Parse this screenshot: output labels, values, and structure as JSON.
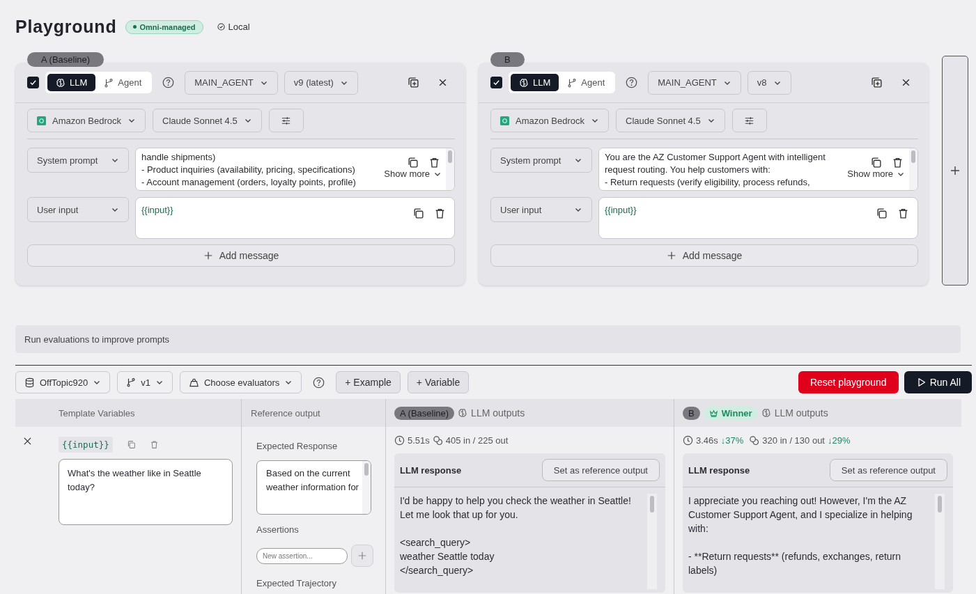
{
  "header": {
    "title": "Playground",
    "badge": "Omni-managed",
    "location": "Local"
  },
  "panels": [
    {
      "tag": "A (Baseline)",
      "enabled": true,
      "modes": [
        {
          "label": "LLM",
          "selected": true
        },
        {
          "label": "Agent",
          "selected": false
        }
      ],
      "agent": "MAIN_AGENT",
      "version": "v9 (latest)",
      "provider": "Amazon Bedrock",
      "model": "Claude Sonnet 4.5",
      "messages": [
        {
          "kind": "system",
          "role": "System prompt",
          "text": "handle shipments)\n- Product inquiries (availability, pricing, specifications)\n- Account management (orders, loyalty points, profile)",
          "show_more": "Show more"
        },
        {
          "kind": "user",
          "role": "User input",
          "text": "{{input}}"
        }
      ],
      "add_message": "Add message"
    },
    {
      "tag": "B",
      "enabled": true,
      "modes": [
        {
          "label": "LLM",
          "selected": true
        },
        {
          "label": "Agent",
          "selected": false
        }
      ],
      "agent": "MAIN_AGENT",
      "version": "v8",
      "provider": "Amazon Bedrock",
      "model": "Claude Sonnet 4.5",
      "messages": [
        {
          "kind": "system",
          "role": "System prompt",
          "text": "You are the AZ Customer Support Agent with intelligent\nrequest routing. You help customers with:\n- Return requests (verify eligibility, process refunds,",
          "show_more": "Show more"
        },
        {
          "kind": "user",
          "role": "User input",
          "text": "{{input}}"
        }
      ],
      "add_message": "Add message"
    }
  ],
  "hint": "Run evaluations to improve prompts",
  "toolbar": {
    "dataset": "OffTopic920",
    "dataset_version": "v1",
    "evaluators": "Choose evaluators",
    "add_example": "+ Example",
    "add_variable": "+ Variable",
    "reset": "Reset playground",
    "run": "Run All"
  },
  "table": {
    "columns": [
      {
        "label": "Template Variables"
      },
      {
        "label": "Reference output"
      }
    ],
    "row": {
      "variable": "{{input}}",
      "value": "What's the weather like in Seattle today?",
      "reference_label": "Expected Response",
      "reference_text": "Based on the current weather information for",
      "assertions_label": "Assertions",
      "assertion_placeholder": "New assertion...",
      "trajectory_label": "Expected Trajectory"
    },
    "outputs": [
      {
        "tag": "A (Baseline)",
        "title": "LLM outputs",
        "time": "5.51s",
        "tokens": "405 in / 225 out",
        "response_label": "LLM response",
        "set_reference": "Set as reference output",
        "response": "I'd be happy to help you check the weather in Seattle!\nLet me look that up for you.\n\n<search_query>\nweather Seattle today\n</search_query>"
      },
      {
        "tag": "B",
        "winner": "Winner",
        "title": "LLM outputs",
        "time": "3.46s",
        "time_delta": "↓37%",
        "tokens": "320 in / 130 out",
        "token_delta": "↓29%",
        "response_label": "LLM response",
        "set_reference": "Set as reference output",
        "response": "I appreciate you reaching out! However, I'm the AZ\nCustomer Support Agent, and I specialize in helping\nwith:\n\n- **Return requests** (refunds, exchanges, return\nlabels)"
      }
    ]
  }
}
